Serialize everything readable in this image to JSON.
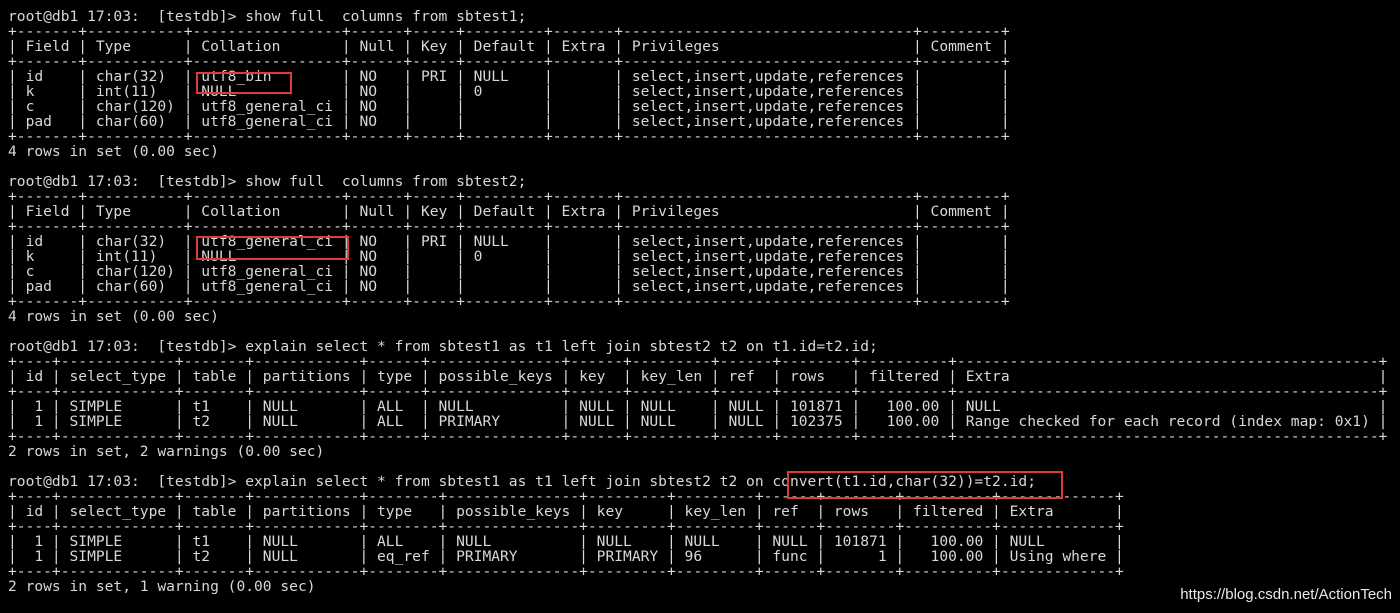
{
  "terminal": {
    "lines": [
      "",
      "root@db1 17:03:  [testdb]> show full  columns from sbtest1;",
      "+-------+-----------+-----------------+------+-----+---------+-------+---------------------------------+---------+",
      "| Field | Type      | Collation       | Null | Key | Default | Extra | Privileges                      | Comment |",
      "+-------+-----------+-----------------+------+-----+---------+-------+---------------------------------+---------+",
      "| id    | char(32)  | utf8_bin        | NO   | PRI | NULL    |       | select,insert,update,references |         |",
      "| k     | int(11)   | NULL            | NO   |     | 0       |       | select,insert,update,references |         |",
      "| c     | char(120) | utf8_general_ci | NO   |     |         |       | select,insert,update,references |         |",
      "| pad   | char(60)  | utf8_general_ci | NO   |     |         |       | select,insert,update,references |         |",
      "+-------+-----------+-----------------+------+-----+---------+-------+---------------------------------+---------+",
      "4 rows in set (0.00 sec)",
      "",
      "root@db1 17:03:  [testdb]> show full  columns from sbtest2;",
      "+-------+-----------+-----------------+------+-----+---------+-------+---------------------------------+---------+",
      "| Field | Type      | Collation       | Null | Key | Default | Extra | Privileges                      | Comment |",
      "+-------+-----------+-----------------+------+-----+---------+-------+---------------------------------+---------+",
      "| id    | char(32)  | utf8_general_ci | NO   | PRI | NULL    |       | select,insert,update,references |         |",
      "| k     | int(11)   | NULL            | NO   |     | 0       |       | select,insert,update,references |         |",
      "| c     | char(120) | utf8_general_ci | NO   |     |         |       | select,insert,update,references |         |",
      "| pad   | char(60)  | utf8_general_ci | NO   |     |         |       | select,insert,update,references |         |",
      "+-------+-----------+-----------------+------+-----+---------+-------+---------------------------------+---------+",
      "4 rows in set (0.00 sec)",
      "",
      "root@db1 17:03:  [testdb]> explain select * from sbtest1 as t1 left join sbtest2 t2 on t1.id=t2.id;",
      "+----+-------------+-------+------------+------+---------------+------+---------+------+--------+----------+------------------------------------------------+",
      "| id | select_type | table | partitions | type | possible_keys | key  | key_len | ref  | rows   | filtered | Extra                                          |",
      "+----+-------------+-------+------------+------+---------------+------+---------+------+--------+----------+------------------------------------------------+",
      "|  1 | SIMPLE      | t1    | NULL       | ALL  | NULL          | NULL | NULL    | NULL | 101871 |   100.00 | NULL                                           |",
      "|  1 | SIMPLE      | t2    | NULL       | ALL  | PRIMARY       | NULL | NULL    | NULL | 102375 |   100.00 | Range checked for each record (index map: 0x1) |",
      "+----+-------------+-------+------------+------+---------------+------+---------+------+--------+----------+------------------------------------------------+",
      "2 rows in set, 2 warnings (0.00 sec)",
      "",
      "root@db1 17:03:  [testdb]> explain select * from sbtest1 as t1 left join sbtest2 t2 on convert(t1.id,char(32))=t2.id;",
      "+----+-------------+-------+------------+--------+---------------+---------+---------+------+--------+----------+-------------+",
      "| id | select_type | table | partitions | type   | possible_keys | key     | key_len | ref  | rows   | filtered | Extra       |",
      "+----+-------------+-------+------------+--------+---------------+---------+---------+------+--------+----------+-------------+",
      "|  1 | SIMPLE      | t1    | NULL       | ALL    | NULL          | NULL    | NULL    | NULL | 101871 |   100.00 | NULL        |",
      "|  1 | SIMPLE      | t2    | NULL       | eq_ref | PRIMARY       | PRIMARY | 96      | func |      1 |   100.00 | Using where |",
      "+----+-------------+-------+------------+--------+---------------+---------+---------+------+--------+----------+-------------+",
      "2 rows in set, 1 warning (0.00 sec)"
    ]
  },
  "watermark": "https://blog.csdn.net/ActionTech"
}
